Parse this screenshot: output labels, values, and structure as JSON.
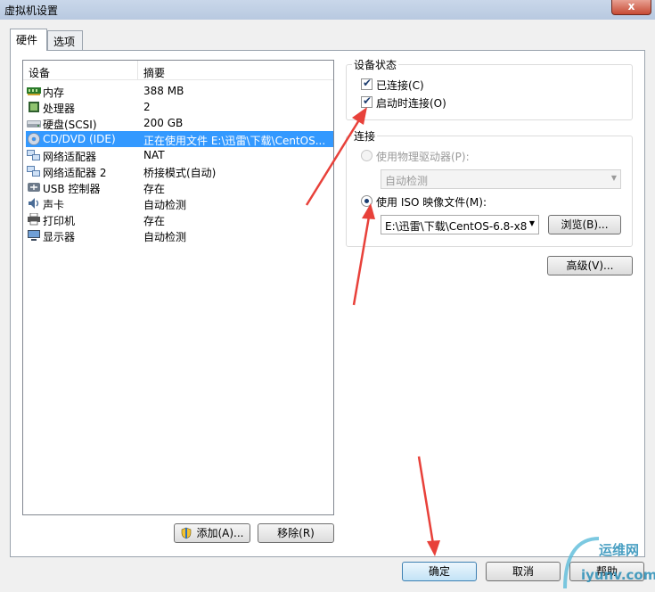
{
  "window": {
    "title": "虚拟机设置",
    "close_glyph": "x"
  },
  "tabs": [
    {
      "label": "硬件"
    },
    {
      "label": "选项"
    }
  ],
  "devices": {
    "headers": {
      "device": "设备",
      "summary": "摘要"
    },
    "rows": [
      {
        "name": "内存",
        "summary": "388 MB",
        "icon": "memory-icon"
      },
      {
        "name": "处理器",
        "summary": "2",
        "icon": "processor-icon"
      },
      {
        "name": "硬盘(SCSI)",
        "summary": "200 GB",
        "icon": "hard-disk-icon"
      },
      {
        "name": "CD/DVD (IDE)",
        "summary": "正在使用文件 E:\\迅雷\\下载\\CentOS...",
        "icon": "cd-dvd-icon",
        "selected": true
      },
      {
        "name": "网络适配器",
        "summary": "NAT",
        "icon": "network-adapter-icon"
      },
      {
        "name": "网络适配器 2",
        "summary": "桥接模式(自动)",
        "icon": "network-adapter-icon"
      },
      {
        "name": "USB 控制器",
        "summary": "存在",
        "icon": "usb-icon"
      },
      {
        "name": "声卡",
        "summary": "自动检测",
        "icon": "sound-card-icon"
      },
      {
        "name": "打印机",
        "summary": "存在",
        "icon": "printer-icon"
      },
      {
        "name": "显示器",
        "summary": "自动检测",
        "icon": "display-icon"
      }
    ]
  },
  "list_buttons": {
    "add": "添加(A)...",
    "remove": "移除(R)"
  },
  "device_status": {
    "title": "设备状态",
    "connected": {
      "label": "已连接(C)",
      "checked": true
    },
    "connect_at_power_on": {
      "label": "启动时连接(O)",
      "checked": true
    }
  },
  "connection": {
    "title": "连接",
    "physical_drive": {
      "label": "使用物理驱动器(P):",
      "selected": false,
      "enabled": false
    },
    "physical_drive_value": "自动检测",
    "iso_image": {
      "label": "使用 ISO 映像文件(M):",
      "selected": true
    },
    "iso_path": "E:\\迅雷\\下载\\CentOS-6.8-x8",
    "browse_label": "浏览(B)..."
  },
  "advanced_label": "高级(V)...",
  "footer": {
    "ok": "确定",
    "cancel": "取消",
    "help": "帮助"
  },
  "watermark": {
    "top": "运维网",
    "bottom": "iyunv.com"
  },
  "colors": {
    "selection": "#3399ff",
    "annotation_arrow": "#e8413a",
    "dialog_bg": "#f0f0f0"
  }
}
